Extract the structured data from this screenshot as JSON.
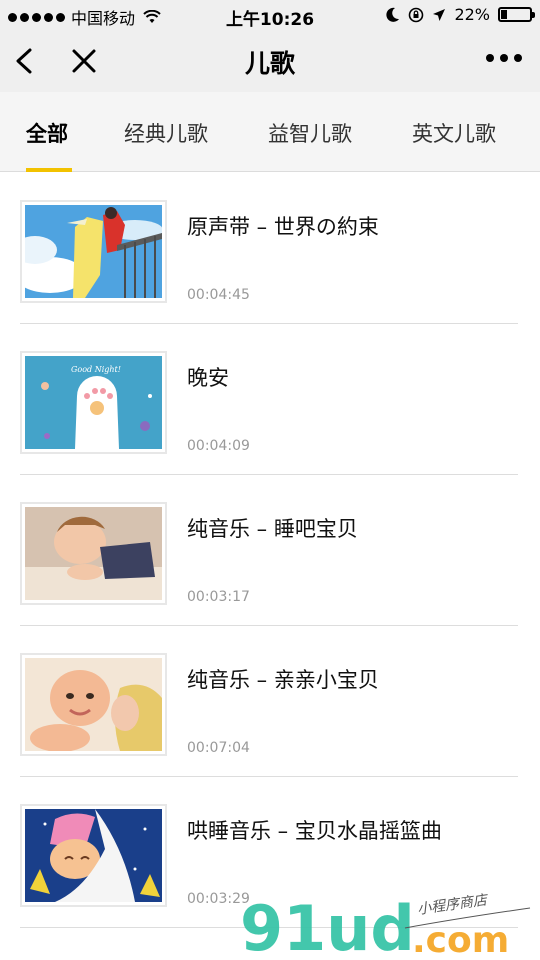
{
  "status": {
    "carrier": "中国移动",
    "time": "上午10:26",
    "battery": "22%",
    "battery_level": 0.22
  },
  "nav": {
    "title": "儿歌"
  },
  "tabs": [
    {
      "label": "全部",
      "active": true
    },
    {
      "label": "经典儿歌",
      "active": false
    },
    {
      "label": "益智儿歌",
      "active": false
    },
    {
      "label": "英文儿歌",
      "active": false
    }
  ],
  "items": [
    {
      "title": "原声带 – 世界の約束",
      "duration": "00:04:45"
    },
    {
      "title": "晚安",
      "duration": "00:04:09"
    },
    {
      "title": "纯音乐 – 睡吧宝贝",
      "duration": "00:03:17"
    },
    {
      "title": "纯音乐 – 亲亲小宝贝",
      "duration": "00:07:04"
    },
    {
      "title": "哄睡音乐 – 宝贝水晶摇篮曲",
      "duration": "00:03:29"
    }
  ],
  "thumb2_text": "Good Night!",
  "watermark": {
    "brand": "91ud",
    "domain": ".com",
    "tagline": "小程序商店"
  },
  "colors": {
    "accent": "#f2c200",
    "watermark_green": "#34c3a6",
    "watermark_orange": "#f5a623"
  }
}
